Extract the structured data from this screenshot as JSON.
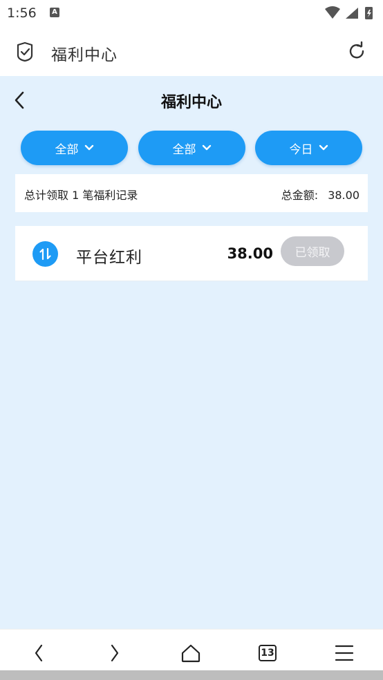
{
  "status_bar": {
    "time": "1:56",
    "notification_letter": "A"
  },
  "browser": {
    "title": "福利中心",
    "tab_count": "13"
  },
  "page": {
    "title": "福利中心"
  },
  "filters": [
    {
      "label": "全部"
    },
    {
      "label": "全部"
    },
    {
      "label": "今日"
    }
  ],
  "summary": {
    "records_text": "总计领取 1 笔福利记录",
    "total_label": "总金额:",
    "total_value": "38.00"
  },
  "records": [
    {
      "name": "平台红利",
      "amount": "38.00",
      "button_label": "已领取"
    }
  ],
  "colors": {
    "accent": "#1e9bf5",
    "page_bg": "#e3f1fd",
    "claimed_button": "#c8c9ce"
  }
}
